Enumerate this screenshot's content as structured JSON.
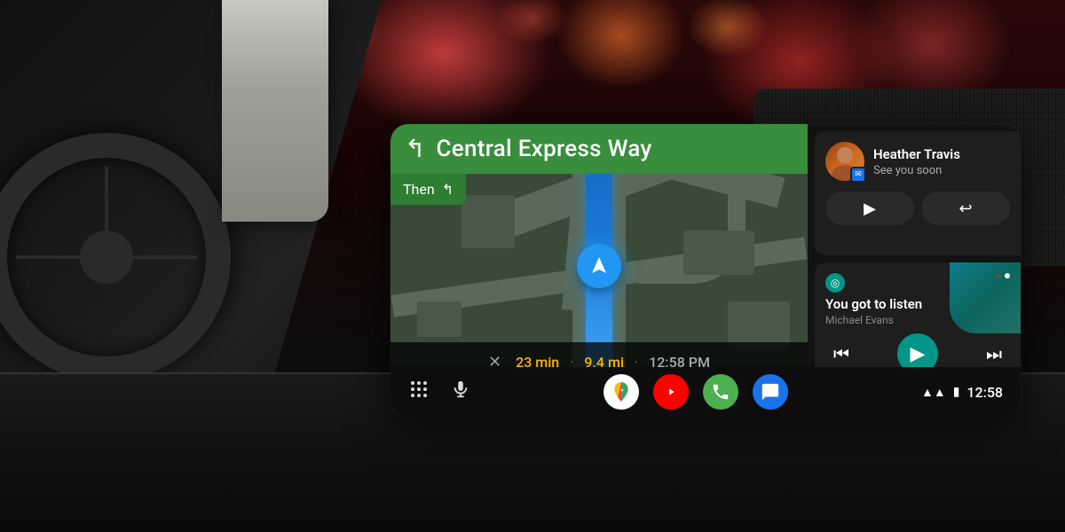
{
  "background": {
    "desc": "Car interior with Android Auto display"
  },
  "display": {
    "navigation": {
      "street": "Central Express Way",
      "turn_icon": "↰",
      "then_label": "Then",
      "then_icon": "↰",
      "eta_close_icon": "✕",
      "eta_time": "23 min",
      "eta_distance": "9.4 mi",
      "eta_clock": "12:58 PM"
    },
    "message": {
      "contact_name": "Heather Travis",
      "message_text": "See you soon",
      "play_icon": "▶",
      "reply_icon": "↩",
      "badge_icon": "✉"
    },
    "music": {
      "song_title": "You got to listen",
      "artist": "Michael Evans",
      "prev_icon": "⏮",
      "play_icon": "▶",
      "next_icon": "⏭",
      "service_icon": "◎"
    },
    "bottom_nav": {
      "grid_icon": "⋮⋮⋮",
      "mic_icon": "🎤",
      "maps_label": "G",
      "youtube_label": "▶",
      "phone_label": "📞",
      "messages_label": "✉",
      "time": "12:58",
      "signal": "📶",
      "battery": "🔋"
    }
  }
}
